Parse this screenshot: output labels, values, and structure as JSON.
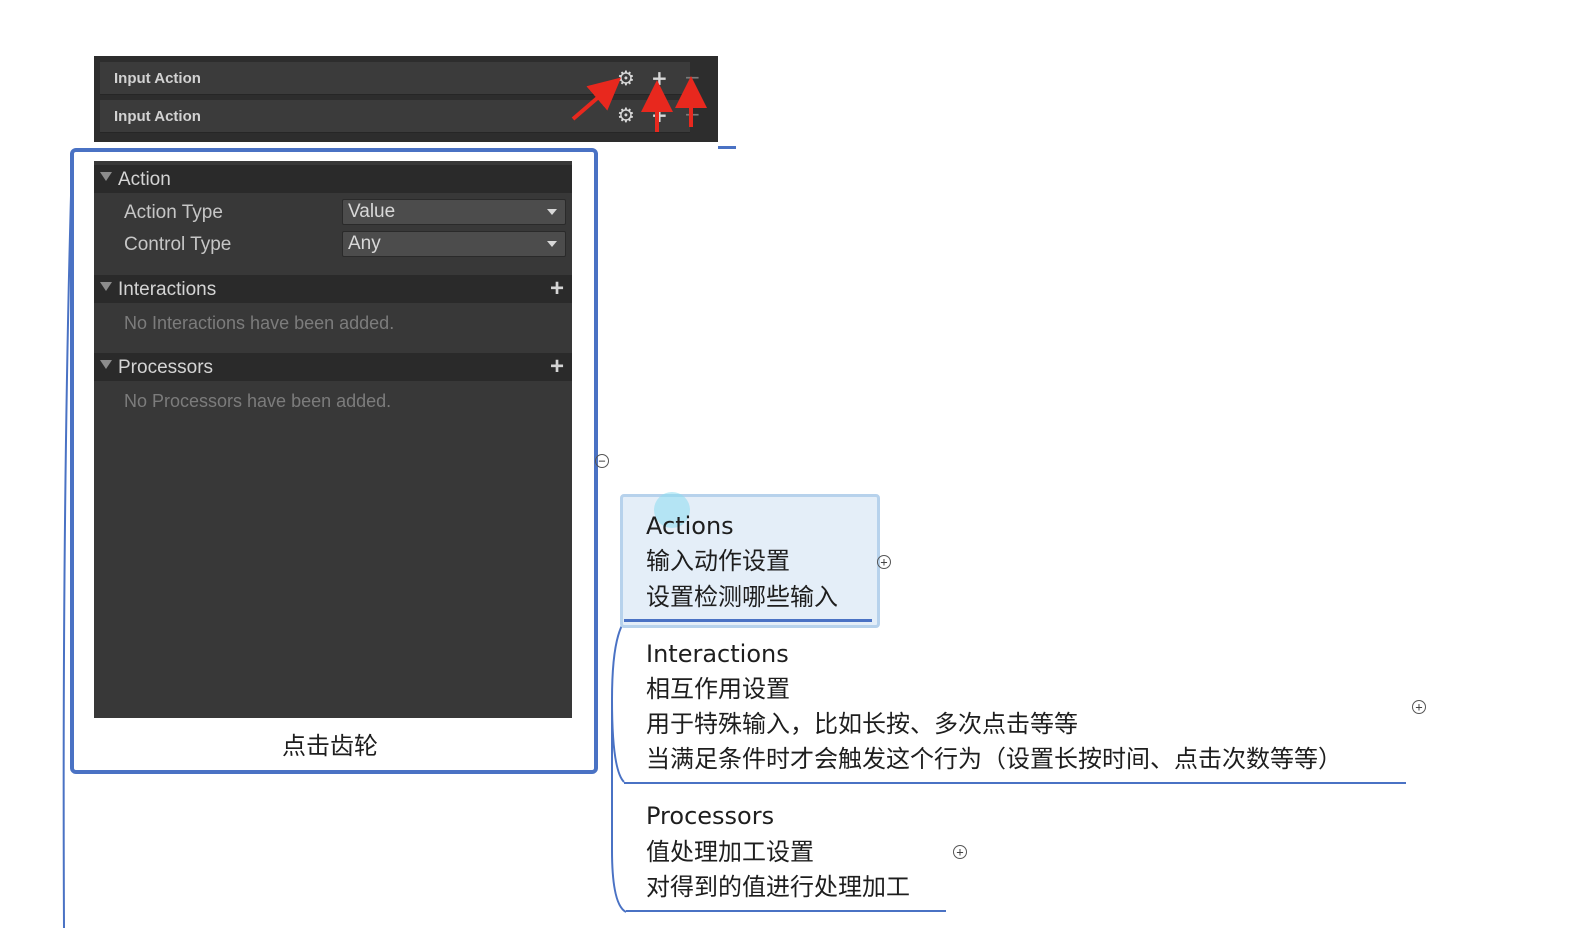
{
  "input_action_rows": [
    {
      "label": "Input Action"
    },
    {
      "label": "Input Action"
    }
  ],
  "icons": {
    "gear": "gear-icon",
    "plus": "plus-icon",
    "minus": "minus-icon",
    "annotation_arrow": "red-arrow-icon",
    "collapse": "collapse-circle-icon",
    "expand": "expand-circle-icon"
  },
  "panel": {
    "action_section": {
      "title": "Action",
      "action_type_label": "Action Type",
      "action_type_value": "Value",
      "control_type_label": "Control Type",
      "control_type_value": "Any"
    },
    "interactions_section": {
      "title": "Interactions",
      "add_label": "+",
      "empty_text": "No Interactions have been added."
    },
    "processors_section": {
      "title": "Processors",
      "add_label": "+",
      "empty_text": "No Processors have been added."
    }
  },
  "caption": "点击齿轮",
  "mindmap": {
    "actions": {
      "title": "Actions",
      "lines": [
        "输入动作设置",
        "设置检测哪些输入"
      ]
    },
    "interactions": {
      "title": "Interactions",
      "lines": [
        "相互作用设置",
        "用于特殊输入，比如长按、多次点击等等",
        "当满足条件时才会触发这个行为（设置长按时间、点击次数等等）"
      ]
    },
    "processors": {
      "title": "Processors",
      "lines": [
        "值处理加工设置",
        "对得到的值进行处理加工"
      ]
    }
  },
  "colors": {
    "branch_line": "#4a72c4",
    "annotation_arrow": "#e8281e",
    "panel_bg": "#383838",
    "selected_node_bg": "#e4eef8"
  }
}
